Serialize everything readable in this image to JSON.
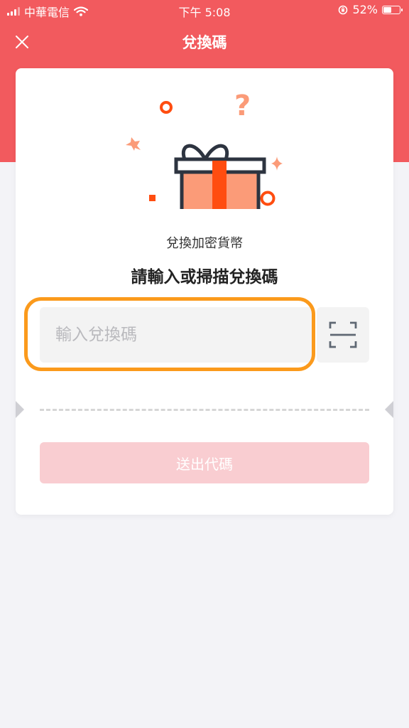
{
  "status_bar": {
    "carrier": "中華電信",
    "time": "下午 5:08",
    "battery_percent": "52%",
    "battery_level": 0.52
  },
  "nav": {
    "title": "兌換碼",
    "close_icon": "close-icon"
  },
  "card": {
    "subtitle": "兌換加密貨幣",
    "title": "請輸入或掃描兌換碼",
    "input_placeholder": "輸入兌換碼",
    "input_value": "",
    "scan_icon": "scan-icon",
    "submit_label": "送出代碼"
  },
  "colors": {
    "header": "#f25a5e",
    "highlight": "#fb9a1c",
    "submit_disabled": "#f9cdd1",
    "gift_body": "#fb9b78",
    "gift_ribbon": "#ff4d10"
  }
}
